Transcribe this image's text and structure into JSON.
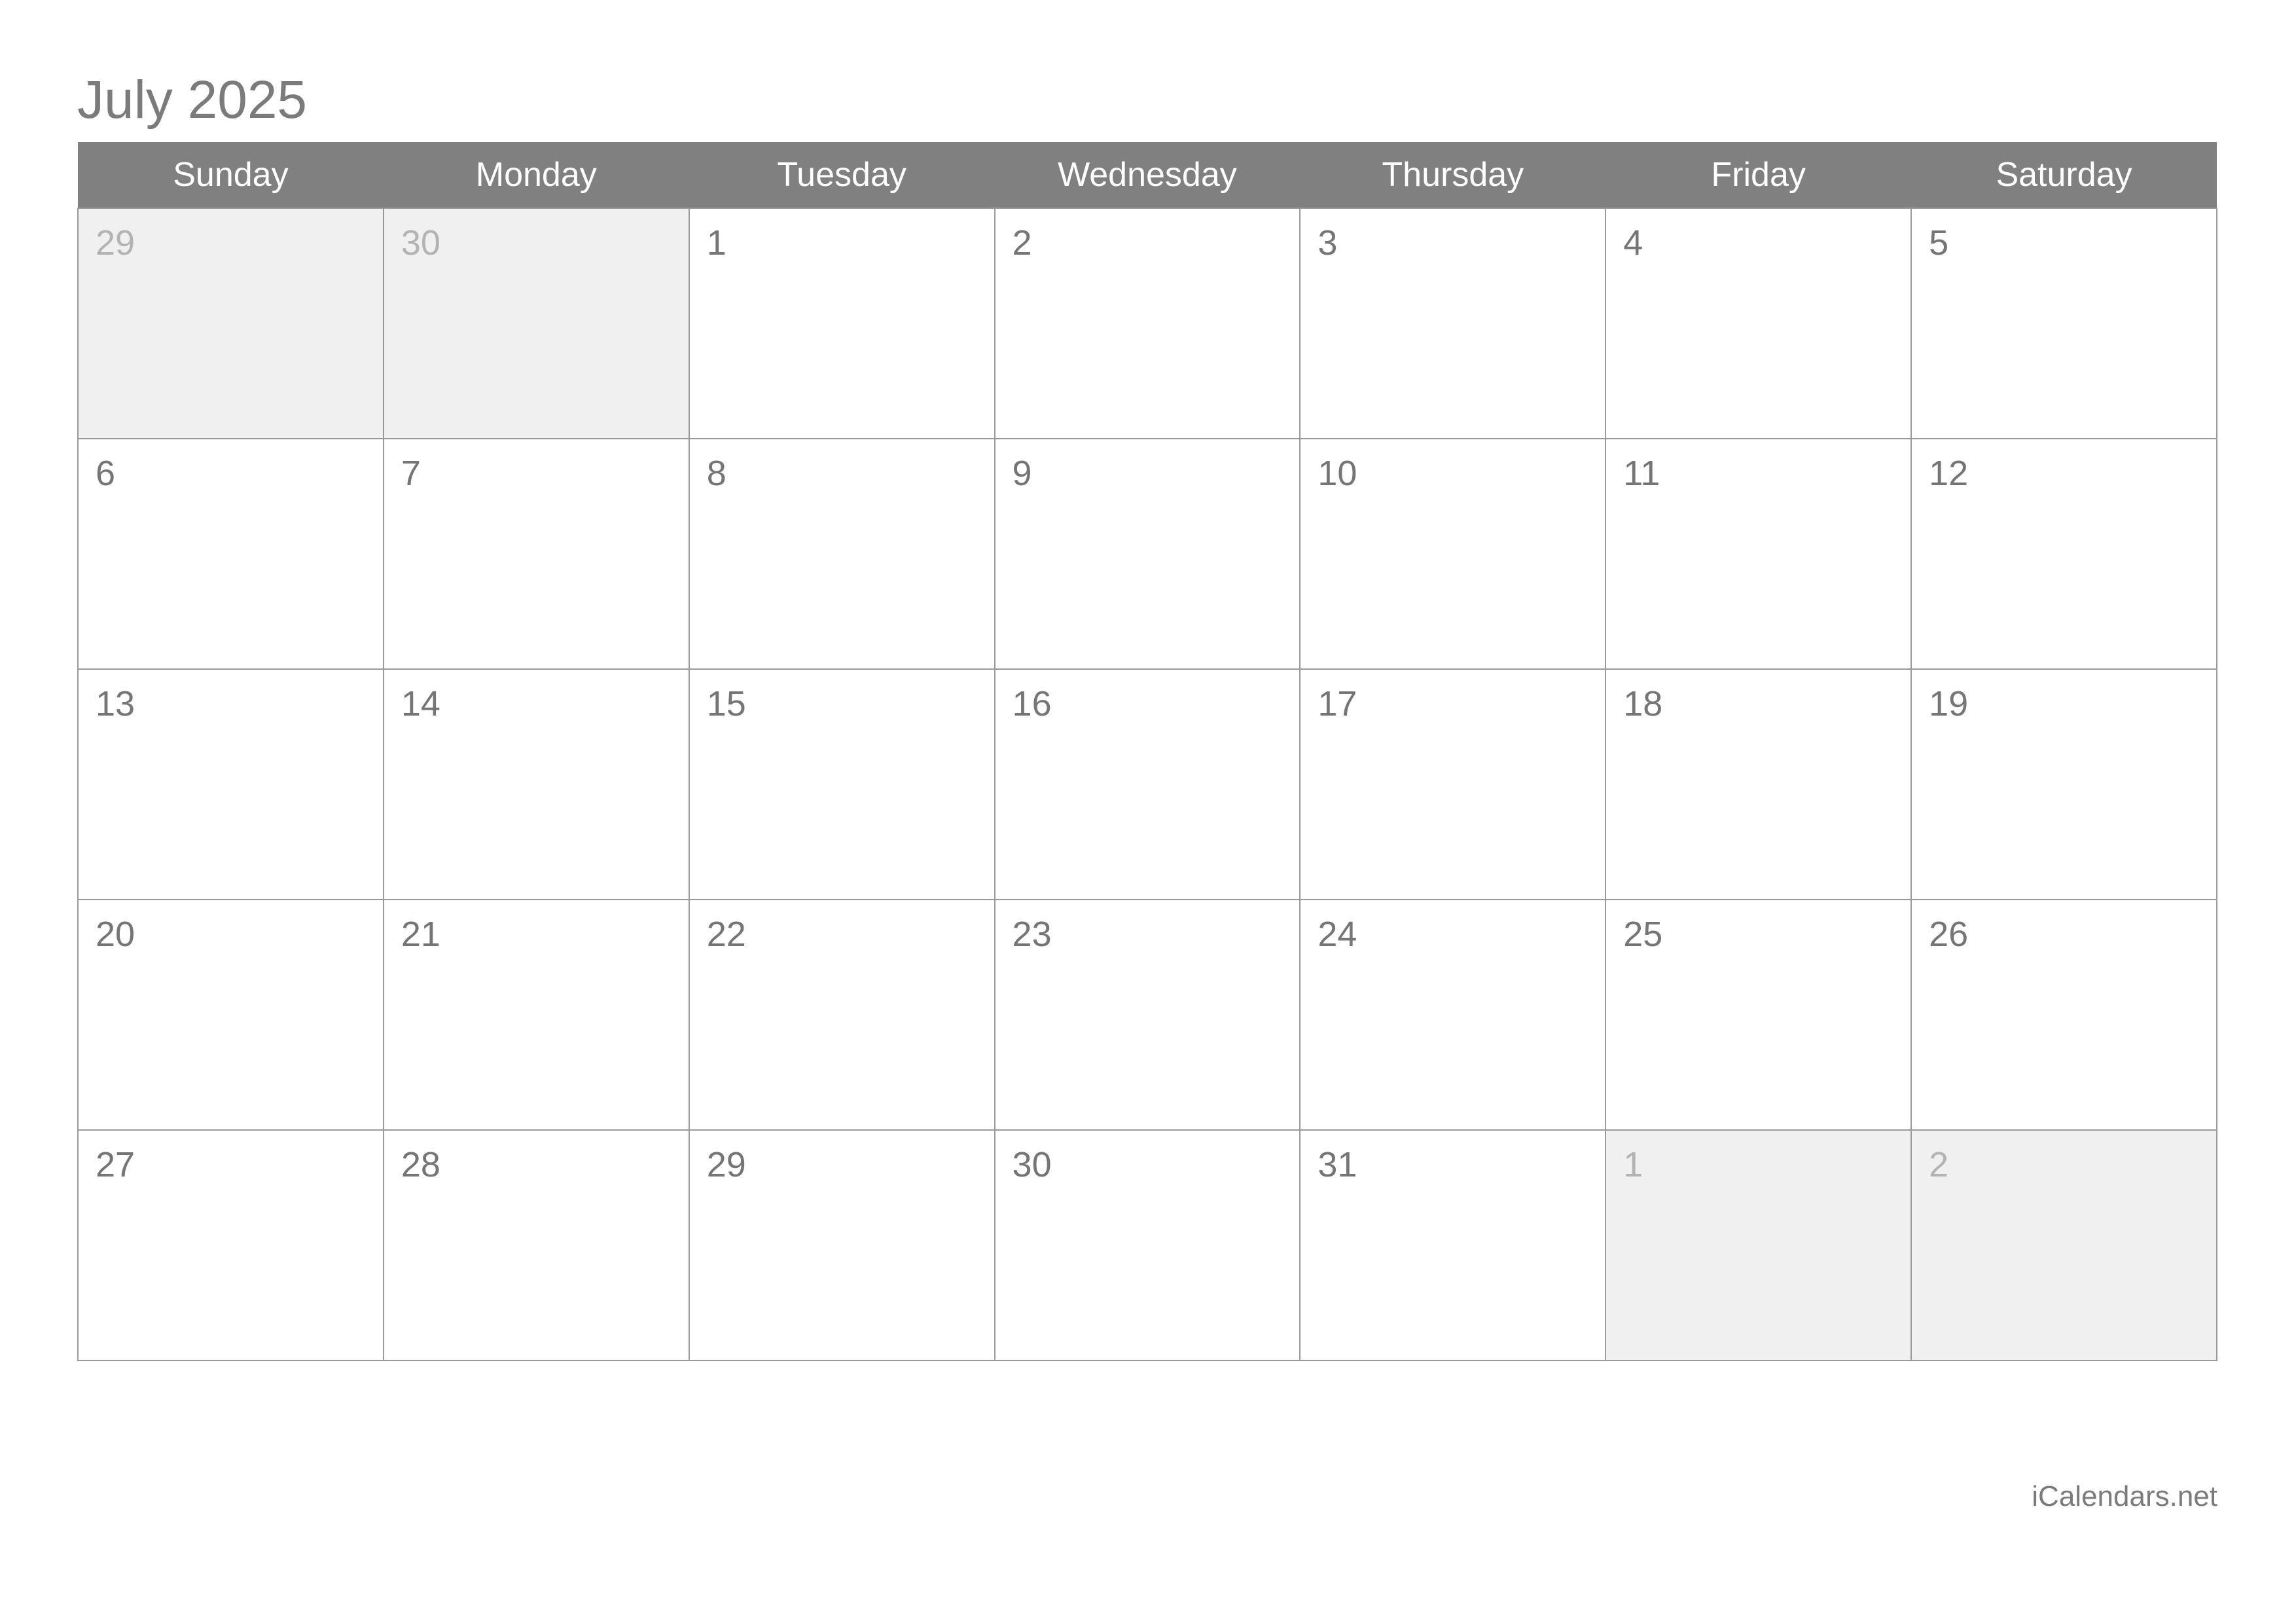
{
  "calendar": {
    "title": "July 2025",
    "month_name": "July",
    "year": "2025",
    "weekday_headers": [
      "Sunday",
      "Monday",
      "Tuesday",
      "Wednesday",
      "Thursday",
      "Friday",
      "Saturday"
    ],
    "weeks": [
      [
        {
          "day": "29",
          "in_month": false
        },
        {
          "day": "30",
          "in_month": false
        },
        {
          "day": "1",
          "in_month": true
        },
        {
          "day": "2",
          "in_month": true
        },
        {
          "day": "3",
          "in_month": true
        },
        {
          "day": "4",
          "in_month": true
        },
        {
          "day": "5",
          "in_month": true
        }
      ],
      [
        {
          "day": "6",
          "in_month": true
        },
        {
          "day": "7",
          "in_month": true
        },
        {
          "day": "8",
          "in_month": true
        },
        {
          "day": "9",
          "in_month": true
        },
        {
          "day": "10",
          "in_month": true
        },
        {
          "day": "11",
          "in_month": true
        },
        {
          "day": "12",
          "in_month": true
        }
      ],
      [
        {
          "day": "13",
          "in_month": true
        },
        {
          "day": "14",
          "in_month": true
        },
        {
          "day": "15",
          "in_month": true
        },
        {
          "day": "16",
          "in_month": true
        },
        {
          "day": "17",
          "in_month": true
        },
        {
          "day": "18",
          "in_month": true
        },
        {
          "day": "19",
          "in_month": true
        }
      ],
      [
        {
          "day": "20",
          "in_month": true
        },
        {
          "day": "21",
          "in_month": true
        },
        {
          "day": "22",
          "in_month": true
        },
        {
          "day": "23",
          "in_month": true
        },
        {
          "day": "24",
          "in_month": true
        },
        {
          "day": "25",
          "in_month": true
        },
        {
          "day": "26",
          "in_month": true
        }
      ],
      [
        {
          "day": "27",
          "in_month": true
        },
        {
          "day": "28",
          "in_month": true
        },
        {
          "day": "29",
          "in_month": true
        },
        {
          "day": "30",
          "in_month": true
        },
        {
          "day": "31",
          "in_month": true
        },
        {
          "day": "1",
          "in_month": false
        },
        {
          "day": "2",
          "in_month": false
        }
      ]
    ],
    "footer": "iCalendars.net",
    "colors": {
      "header_background": "#808080",
      "header_text": "#ffffff",
      "title_text": "#7b7b7b",
      "day_text": "#757575",
      "out_of_month_background": "#f0f0f0",
      "out_of_month_text": "#b3b3b3",
      "grid_border": "#9a9a9a",
      "cell_background": "#ffffff",
      "footer_text": "#7b7b7b"
    }
  }
}
